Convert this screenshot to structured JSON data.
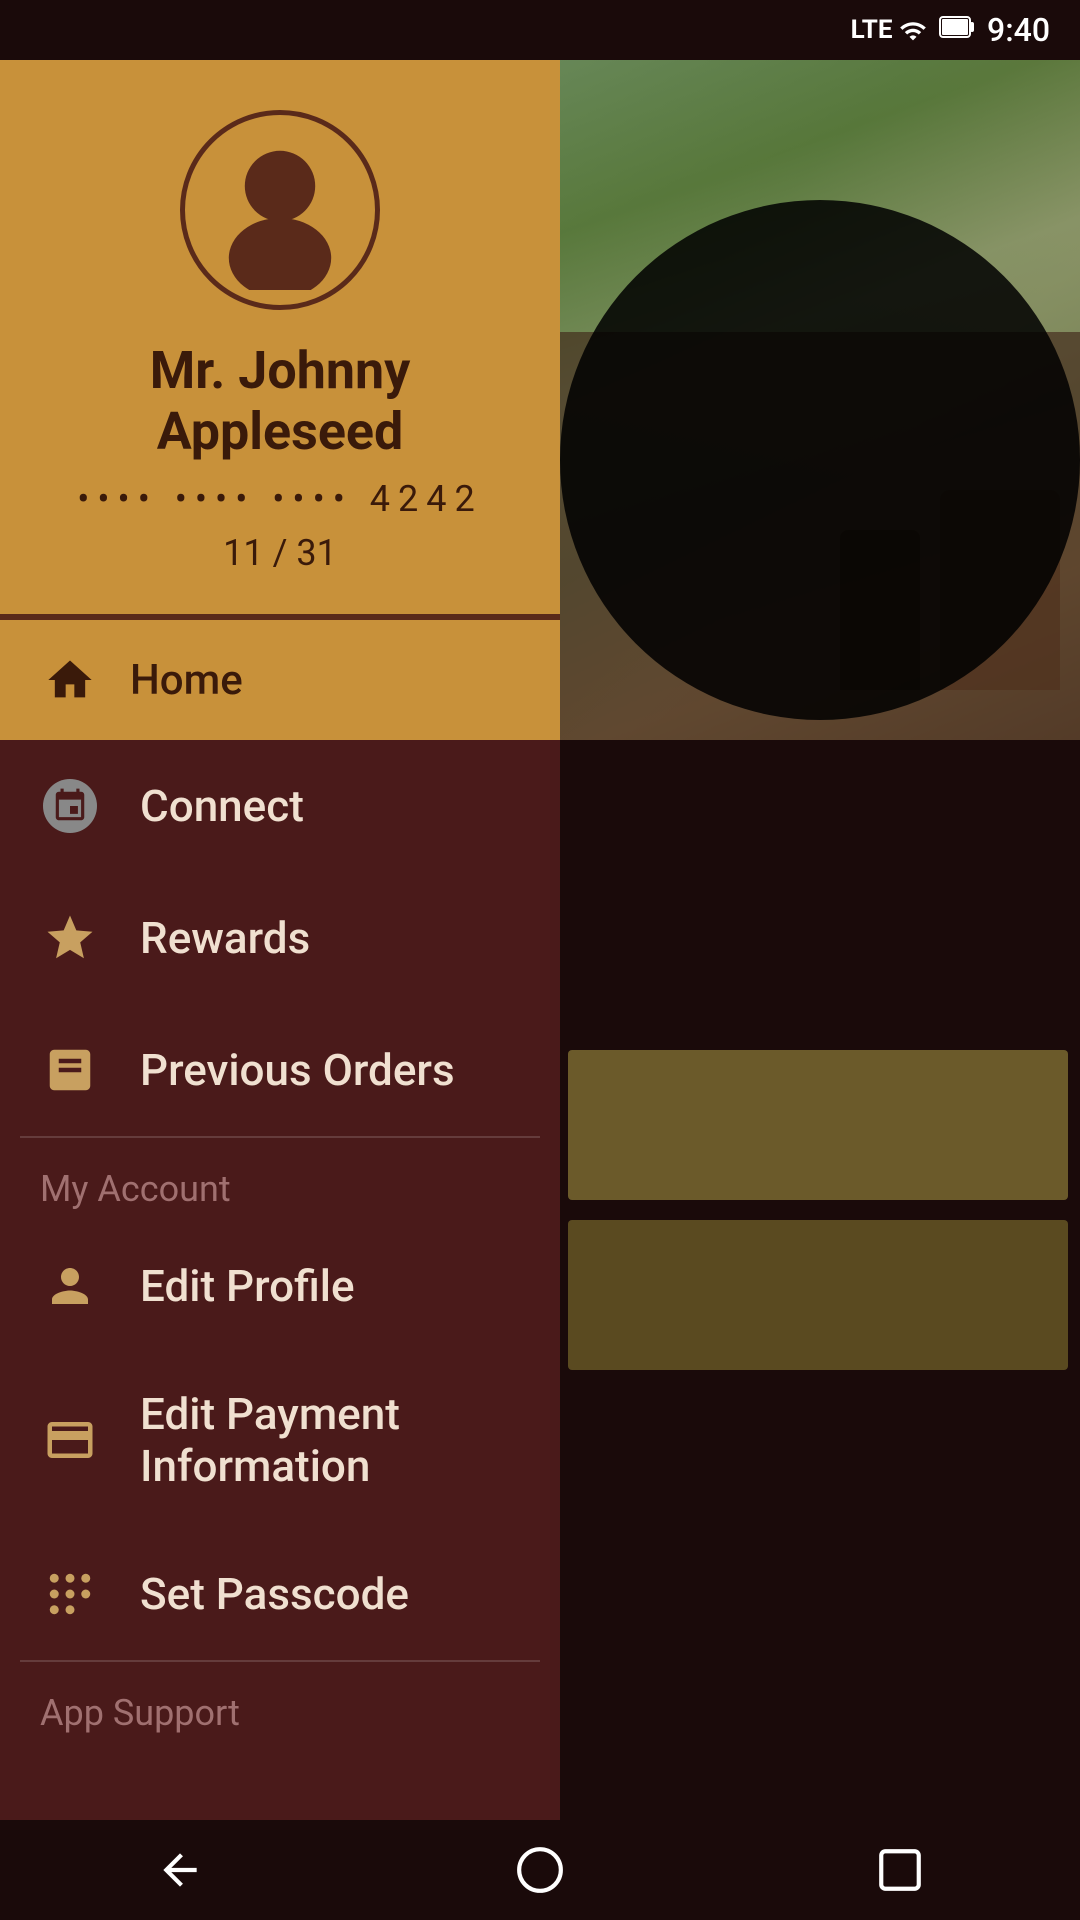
{
  "statusBar": {
    "signal": "LTE",
    "time": "9:40",
    "battery": "full"
  },
  "profile": {
    "name": "Mr. Johnny Appleseed",
    "cardNumber": "•••• •••• •••• 4242",
    "cardExpiry": "11 / 31"
  },
  "nav": {
    "homeLabel": "Home",
    "connectLabel": "Connect",
    "rewardsLabel": "Rewards",
    "previousOrdersLabel": "Previous Orders"
  },
  "myAccount": {
    "sectionLabel": "My Account",
    "editProfileLabel": "Edit Profile",
    "editPaymentLabel": "Edit Payment Information",
    "setPasscodeLabel": "Set Passcode"
  },
  "appSupport": {
    "label": "App Support"
  },
  "bottomNav": {
    "backLabel": "back",
    "homeLabel": "home",
    "recentLabel": "recent"
  }
}
